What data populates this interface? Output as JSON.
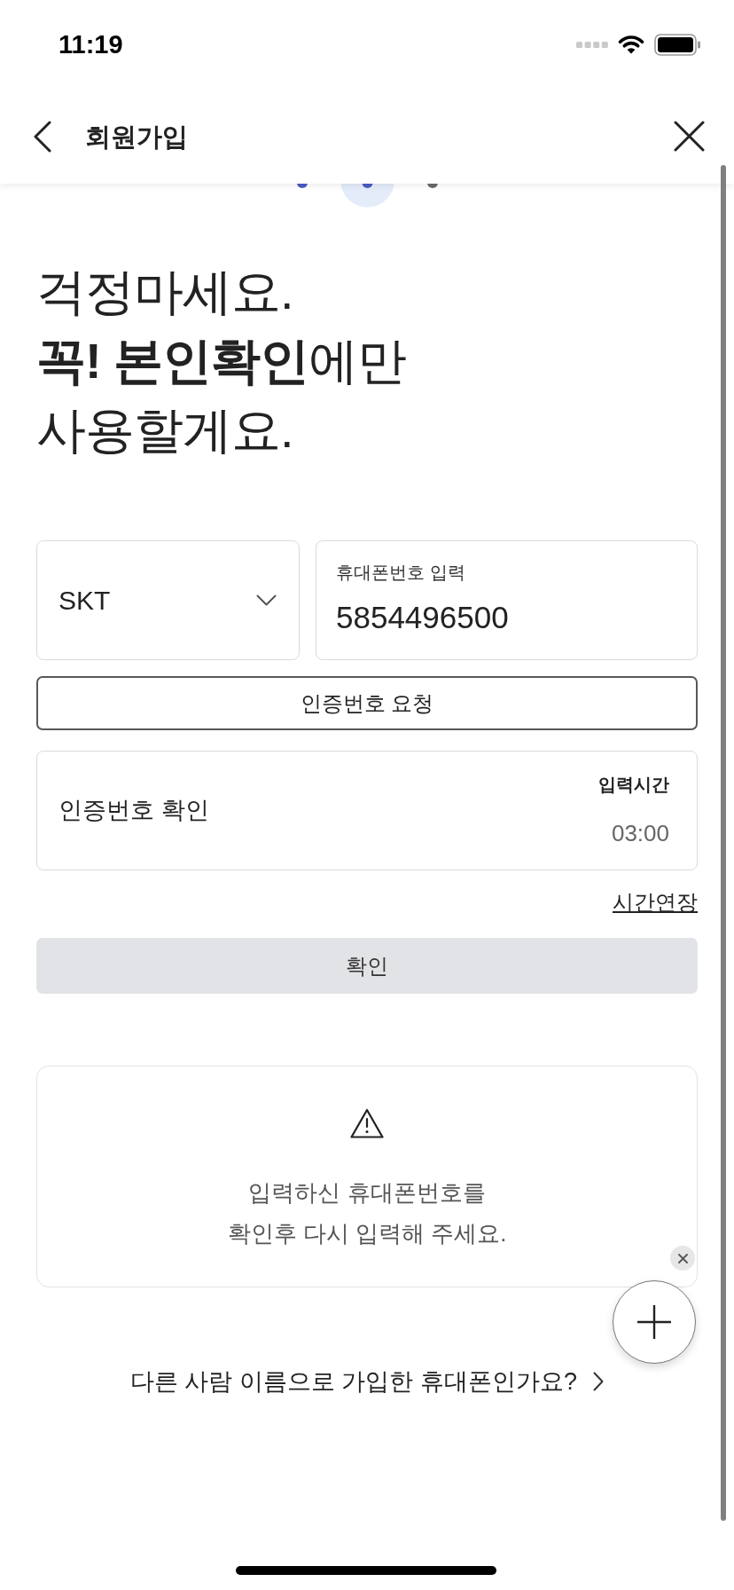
{
  "status_bar": {
    "time": "11:19"
  },
  "header": {
    "title": "회원가입"
  },
  "steps": [
    {
      "reached": true,
      "selected": false
    },
    {
      "reached": true,
      "selected": true
    },
    {
      "reached": false,
      "selected": false
    }
  ],
  "heading": [
    "걱정마세요.",
    "**꼭! 본인확인**에만",
    "사용할게요."
  ],
  "carrier_select": {
    "value": "SKT"
  },
  "phone_field": {
    "label": "휴대폰번호 입력",
    "value": "5854496500"
  },
  "request_button": {
    "label": "인증번호 요청"
  },
  "code_field": {
    "placeholder": "인증번호 확인",
    "timer_label": "입력시간",
    "timer": "03:00"
  },
  "extend_link": {
    "label": "시간연장"
  },
  "confirm_button": {
    "label": "확인",
    "disabled": true
  },
  "notice": {
    "lines": [
      "입력하신 휴대폰번호를",
      "확인후 다시 입력해 주세요."
    ]
  },
  "other_owner_link": {
    "label": "다른 사람 이름으로 가입한 휴대폰인가요?"
  }
}
